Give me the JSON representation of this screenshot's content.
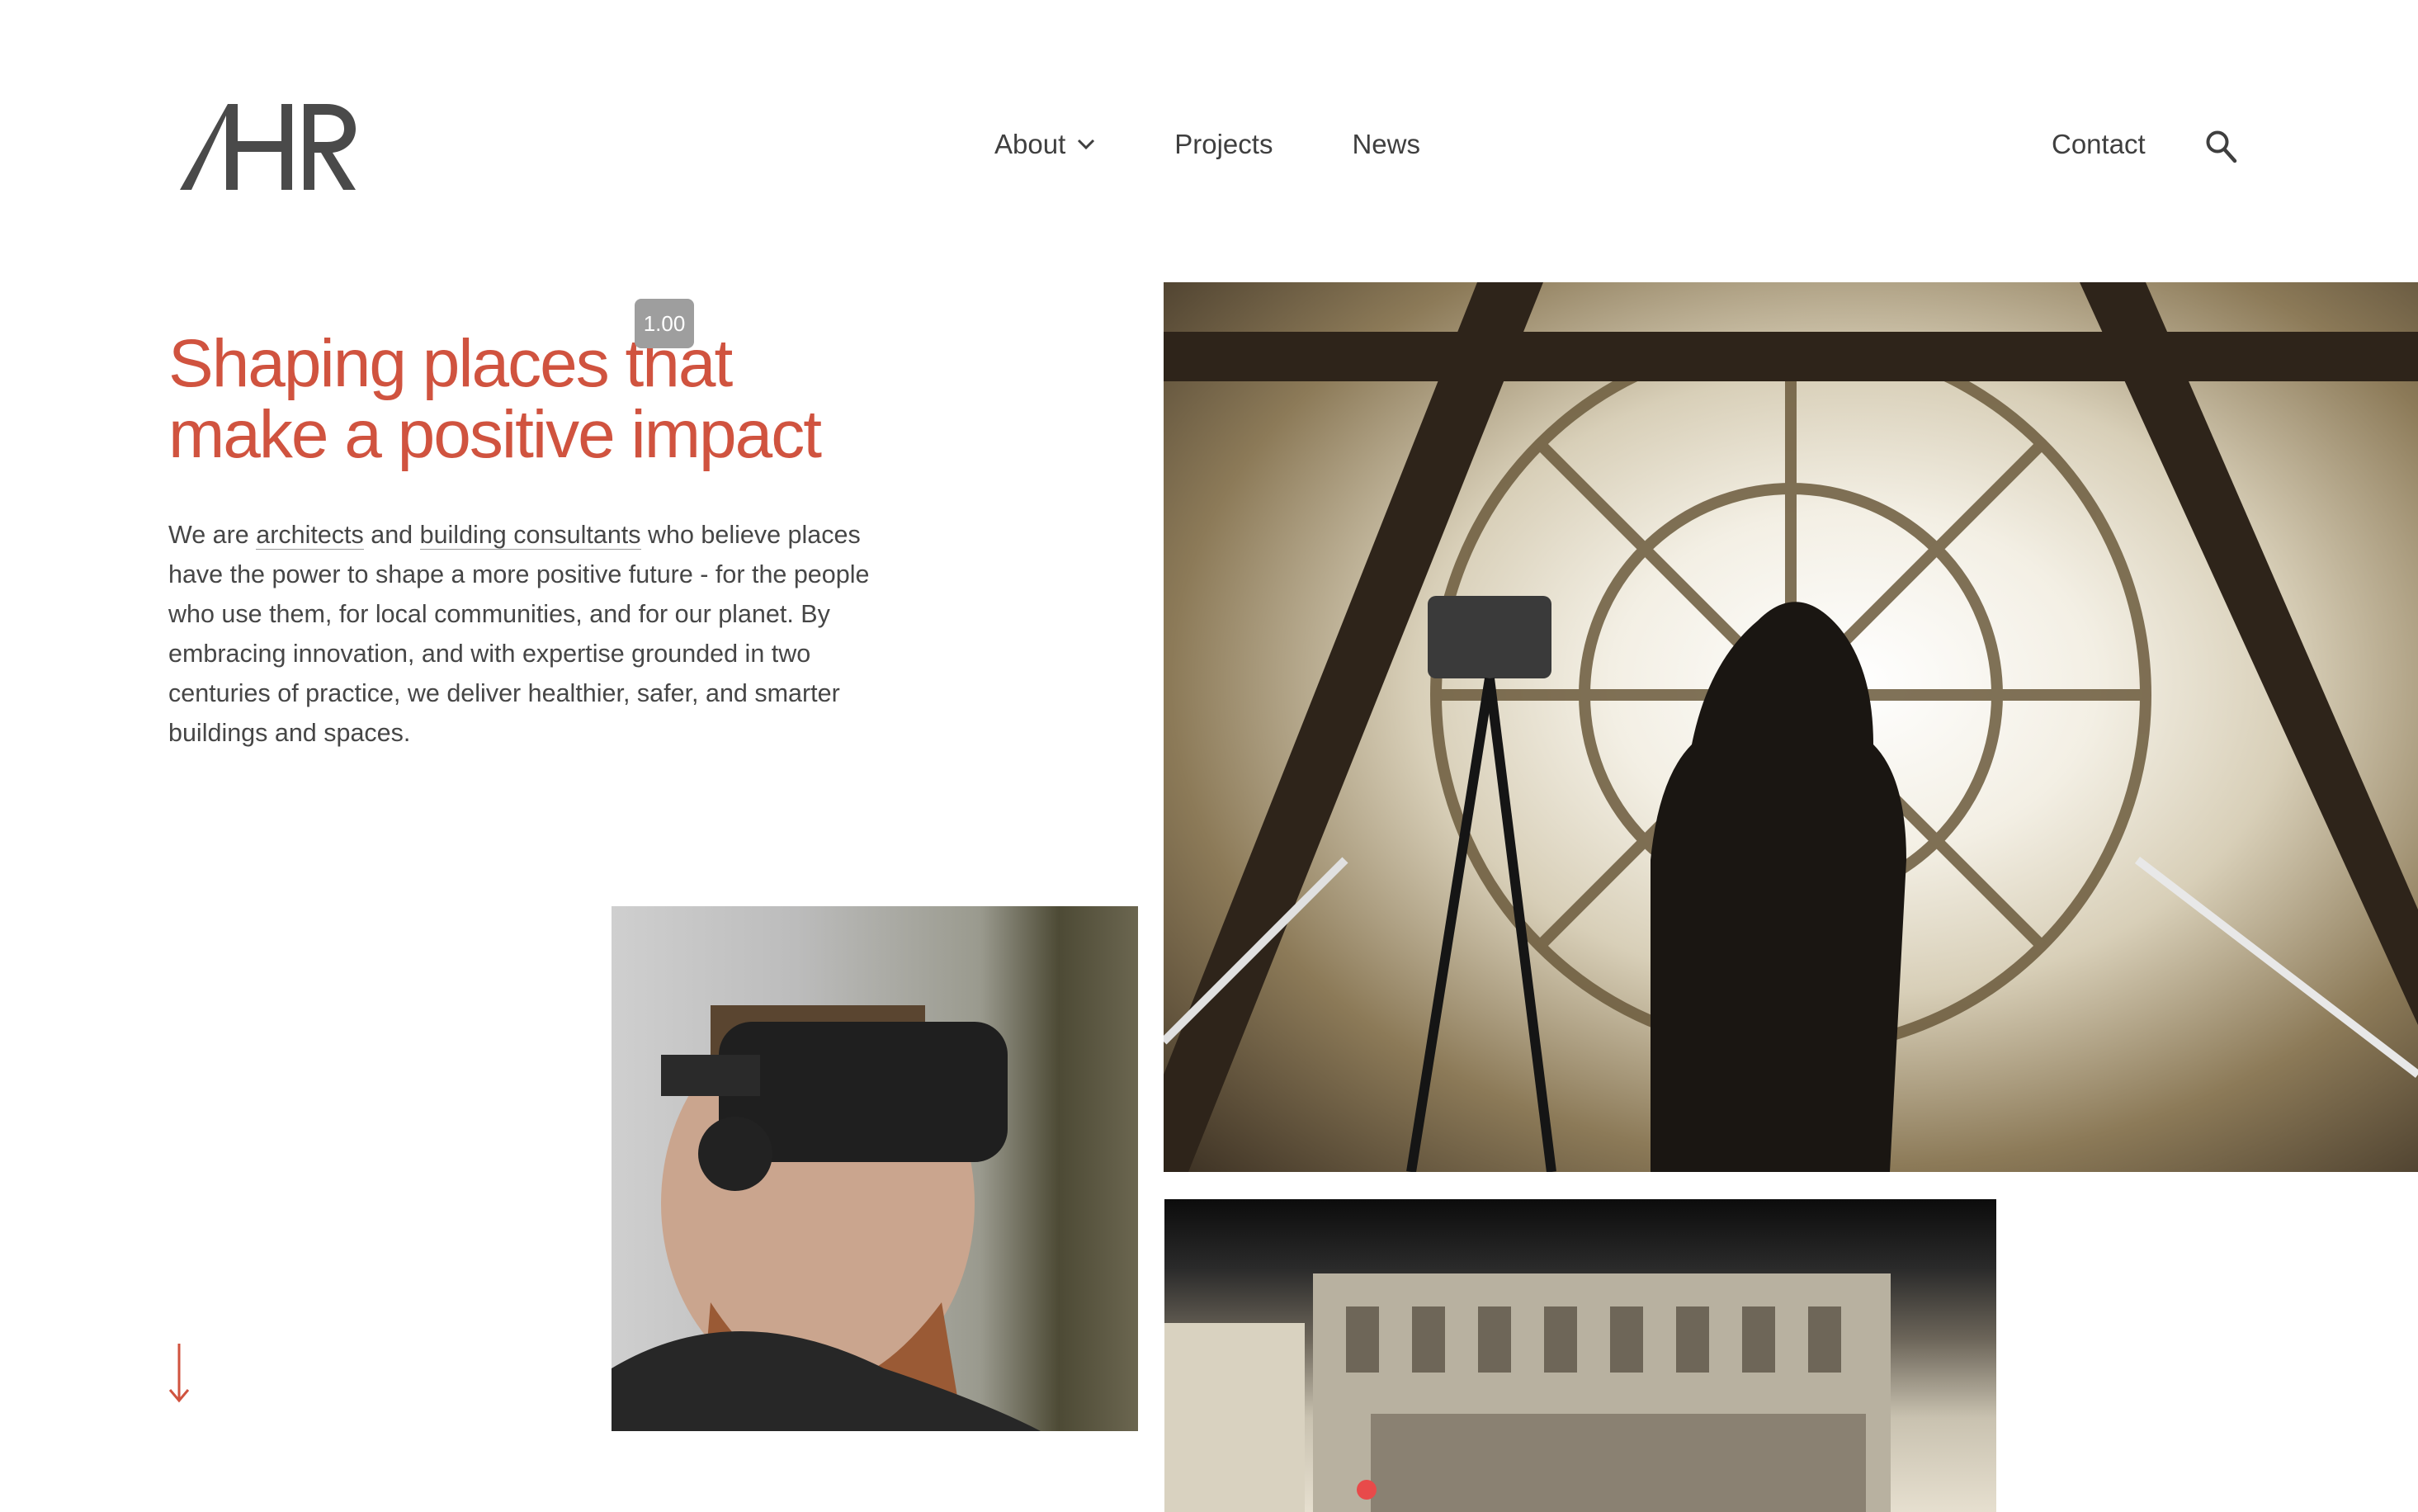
{
  "header": {
    "logo_text": "AHR",
    "nav": [
      {
        "label": "About",
        "has_dropdown": true
      },
      {
        "label": "Projects",
        "has_dropdown": false
      },
      {
        "label": "News",
        "has_dropdown": false
      }
    ],
    "contact_label": "Contact",
    "search_icon": "search-icon"
  },
  "hero": {
    "zoom_badge": "1.00",
    "headline_line1": "Shaping places that",
    "headline_line2": "make a positive impact",
    "intro": {
      "part1": "We are ",
      "link1": "architects",
      "part2": " and ",
      "link2": "building consultants",
      "part3": " who believe places have the power to shape a more positive future - for the people who use them, for local communities, and for our planet. By embracing innovation, and with expertise grounded in two centuries of practice, we deliver healthier, safer, and smarter buildings and spaces."
    },
    "scroll_icon": "arrow-down-icon"
  },
  "colors": {
    "accent": "#d0533f",
    "text": "#3f3f3f",
    "logo": "#4a4a4a",
    "background": "#ffffff"
  }
}
